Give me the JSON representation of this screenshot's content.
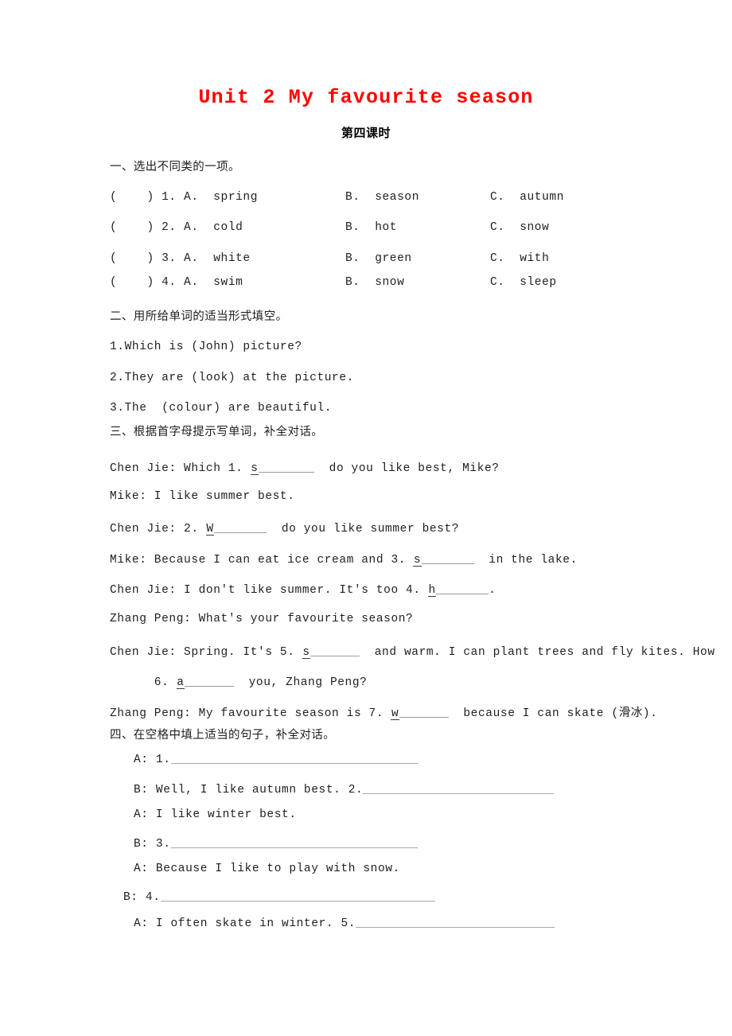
{
  "document": {
    "title": "Unit 2 My favourite season",
    "subtitle": "第四课时",
    "title_color": "#ff0000",
    "body_color": "#1f1f1f"
  },
  "sections": {
    "one": {
      "heading": "一、选出不同类的一项。",
      "rows": [
        {
          "stem": "(    ) 1. A.  spring",
          "b": "B.  season",
          "c": "C.  autumn"
        },
        {
          "stem": "(    ) 2. A.  cold",
          "b": "B.  hot",
          "c": "C.  snow"
        },
        {
          "stem": "(    ) 3. A.  white",
          "b": "B.  green",
          "c": "C.  with"
        },
        {
          "stem": "(    ) 4. A.  swim",
          "b": "B.  snow",
          "c": "C.  sleep"
        }
      ]
    },
    "two": {
      "heading": "二、用所给单词的适当形式填空。",
      "items": [
        "1.Which is (John) picture?",
        "2.They are (look) at the picture.",
        "3.The  (colour) are beautiful."
      ]
    },
    "three": {
      "heading": "三、根据首字母提示写单词，补全对话。",
      "lines": [
        {
          "before": "Chen Jie: Which 1. ",
          "hint": "s",
          "blank_width": 70,
          "after": "  do you like best, Mike?"
        },
        {
          "before": "Mike: I like summer best.",
          "hint": "",
          "blank_width": 0,
          "after": ""
        },
        {
          "before": "Chen Jie: 2. ",
          "hint": "W",
          "blank_width": 66,
          "after": "  do you like summer best?"
        },
        {
          "before": "Mike: Because I can eat ice cream and 3. ",
          "hint": "s",
          "blank_width": 66,
          "after": "  in the lake."
        },
        {
          "before": "Chen Jie: I don't like summer. It's too 4. ",
          "hint": "h",
          "blank_width": 66,
          "after": "."
        },
        {
          "before": "Zhang Peng: What's your favourite season?",
          "hint": "",
          "blank_width": 0,
          "after": ""
        },
        {
          "before": "Chen Jie: Spring. It's 5. ",
          "hint": "s",
          "blank_width": 62,
          "after": "  and warm. I can plant trees and fly kites. How"
        },
        {
          "before": "      6. ",
          "hint": "a",
          "blank_width": 62,
          "after": "  you, Zhang Peng?"
        },
        {
          "before": "Zhang Peng: My favourite season is 7. ",
          "hint": "w",
          "blank_width": 62,
          "after": "  because I can skate (滑冰)."
        }
      ]
    },
    "four": {
      "heading": "四、在空格中填上适当的句子，补全对话。",
      "lines": [
        {
          "text": "A: 1.",
          "blank_width": 310,
          "indent": 168
        },
        {
          "text": "B: Well, I like autumn best. 2.",
          "blank_width": 240,
          "indent": 168
        },
        {
          "text": "A: I like winter best.",
          "blank_width": 0,
          "indent": 168
        },
        {
          "text": "B: 3.",
          "blank_width": 310,
          "indent": 168
        },
        {
          "text": "A: Because I like to play with snow.",
          "blank_width": 0,
          "indent": 168
        },
        {
          "text": "B: 4.",
          "blank_width": 345,
          "indent": 155
        },
        {
          "text": "A: I often skate in winter. 5.",
          "blank_width": 250,
          "indent": 168
        }
      ]
    }
  }
}
